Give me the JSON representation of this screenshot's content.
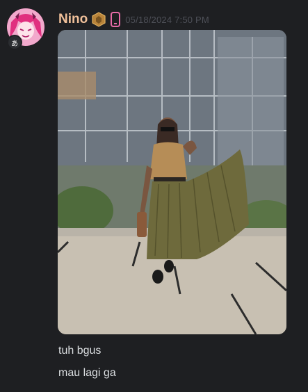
{
  "message": {
    "author": {
      "name": "Nino",
      "name_color": "#f0c09a",
      "avatar_icon": "anime-avatar",
      "badge_icon": "hexagon-badge-icon",
      "device_icon": "mobile-phone-icon"
    },
    "timestamp": "05/18/2024 7:50 PM",
    "attachment": {
      "type": "image",
      "description_icon": "photo-attachment"
    },
    "lines": [
      "tuh bgus",
      "mau lagi ga"
    ]
  }
}
